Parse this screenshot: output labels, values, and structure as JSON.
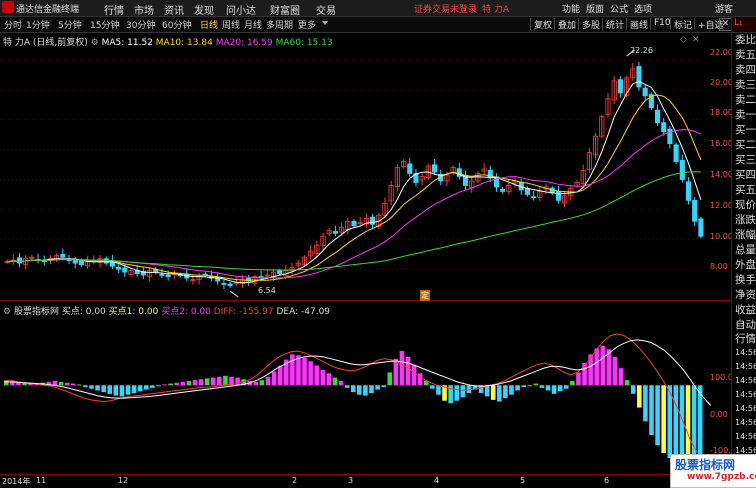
{
  "menubar": {
    "app_name": "通达信金融终端",
    "menus": [
      "行情",
      "市场",
      "资讯",
      "发现",
      "问小达",
      "财富圈",
      "交易"
    ],
    "notice": "证券交易未登录",
    "stock_name": "特 力A",
    "right": [
      "功能",
      "版面",
      "公式",
      "选项",
      "游客"
    ]
  },
  "toolbar": {
    "periods": [
      "分时",
      "1分钟",
      "5分钟",
      "15分钟",
      "30分钟",
      "60分钟",
      "日线",
      "周线",
      "月线",
      "多周期",
      "更多"
    ],
    "active_period": "日线",
    "buttons": [
      "复权",
      "叠加",
      "多股",
      "统计",
      "画线",
      "F10",
      "标记",
      "+自选"
    ]
  },
  "main_legend": {
    "title": "特 力A (日线,前复权)",
    "ma5": "MA5: 11.52",
    "ma10": "MA10: 13.84",
    "ma20": "MA20: 16.59",
    "ma60": "MA60: 15.13"
  },
  "indicator_legend": {
    "name": "股票指标网",
    "buy": "买点: 0.00",
    "buy1": "买点1: 0.00",
    "buy2": "买点2: 0.00",
    "diff": "DIFF: -155.97",
    "dea": "DEA: -47.09"
  },
  "price_axis": [
    "22.00",
    "20.00",
    "18.00",
    "16.00",
    "14.00",
    "12.00",
    "10.00",
    "8.00"
  ],
  "indicator_axis": [
    "100.0",
    "0.00",
    "-100.0"
  ],
  "annotations": {
    "high": "22.26",
    "low": "6.54",
    "marker": "定"
  },
  "x_axis": [
    "2014年",
    "11",
    "12",
    "2",
    "3",
    "4",
    "5",
    "6"
  ],
  "right_panel": [
    "委比",
    "卖五",
    "卖四",
    "卖三",
    "卖二",
    "卖一",
    "买一",
    "买二",
    "买三",
    "买四",
    "买五",
    "现价",
    "涨跌",
    "涨幅",
    "总量",
    "外盘",
    "换手",
    "净资",
    "收益",
    "自动",
    "行情",
    "14:56",
    "14:56",
    "14:56",
    "14:56",
    "14:56",
    "14:56",
    "14:56",
    "14:56"
  ],
  "watermark": {
    "line1": "股票指标网",
    "line2": "www.7gpzb.com"
  },
  "colors": {
    "ma5": "#ffffff",
    "ma10": "#ffd700",
    "ma20": "#ff33ff",
    "ma60": "#33dd33",
    "up": "#ff3b3b",
    "down": "#33d6ff"
  },
  "chart_data": {
    "type": "candlestick",
    "price_ylim": [
      6.0,
      23.0
    ],
    "indicator_ylim": [
      -200,
      150
    ],
    "closes": [
      8.5,
      8.6,
      8.4,
      8.7,
      8.8,
      8.6,
      8.5,
      8.7,
      8.9,
      8.8,
      8.6,
      8.4,
      8.3,
      8.5,
      8.6,
      8.7,
      8.4,
      8.2,
      8.0,
      7.8,
      7.9,
      7.7,
      7.6,
      7.9,
      7.8,
      7.6,
      7.5,
      7.7,
      7.6,
      7.4,
      7.3,
      7.5,
      7.6,
      7.4,
      7.2,
      7.0,
      6.9,
      7.1,
      7.3,
      7.2,
      7.5,
      7.4,
      7.6,
      7.8,
      7.7,
      7.9,
      8.1,
      8.4,
      8.8,
      9.2,
      9.6,
      10.2,
      10.6,
      10.4,
      10.8,
      11.2,
      10.9,
      11.1,
      11.4,
      11.0,
      11.6,
      12.4,
      13.6,
      14.8,
      15.2,
      14.4,
      13.8,
      14.2,
      14.9,
      14.5,
      13.9,
      14.3,
      14.8,
      14.2,
      13.6,
      13.9,
      14.4,
      14.7,
      14.1,
      13.5,
      13.2,
      13.6,
      13.9,
      13.3,
      13.0,
      12.8,
      13.2,
      13.5,
      13.1,
      12.6,
      12.9,
      13.4,
      13.8,
      14.6,
      15.8,
      16.9,
      18.2,
      19.4,
      20.6,
      19.8,
      20.8,
      21.4,
      20.2,
      19.6,
      18.8,
      17.8,
      17.2,
      16.4,
      15.2,
      14.0,
      12.6,
      11.2,
      10.2
    ],
    "highs": {
      "index": 100,
      "value": 22.26
    },
    "lows": {
      "index": 36,
      "value": 6.54
    },
    "macd_bars": [
      12,
      10,
      8,
      6,
      5,
      4,
      6,
      8,
      10,
      8,
      6,
      4,
      2,
      -4,
      -8,
      -12,
      -16,
      -20,
      -24,
      -26,
      -22,
      -18,
      -14,
      -10,
      -6,
      -2,
      2,
      4,
      6,
      8,
      10,
      12,
      14,
      16,
      18,
      20,
      22,
      20,
      18,
      14,
      10,
      8,
      12,
      20,
      32,
      46,
      60,
      72,
      70,
      64,
      56,
      46,
      36,
      28,
      18,
      10,
      -6,
      -16,
      -22,
      -24,
      -18,
      -10,
      -4,
      30,
      62,
      80,
      66,
      48,
      28,
      10,
      -8,
      -22,
      -36,
      -42,
      -36,
      -28,
      -18,
      -10,
      -18,
      -26,
      -34,
      -38,
      -30,
      -22,
      -12,
      -4,
      -2,
      4,
      -6,
      -12,
      -20,
      -14,
      -8,
      10,
      30,
      52,
      72,
      86,
      92,
      84,
      66,
      40,
      12,
      -20,
      -52,
      -84,
      -116,
      -140,
      -158,
      -170,
      -176,
      -180,
      -182,
      -184,
      -185
    ],
    "diff": [
      10,
      12,
      8,
      6,
      4,
      2,
      0,
      -2,
      -6,
      -12,
      -18,
      -24,
      -30,
      -34,
      -36,
      -38,
      -36,
      -32,
      -28,
      -26,
      -24,
      -22,
      -20,
      -18,
      -16,
      -14,
      -12,
      -10,
      -8,
      -6,
      -5,
      -4,
      -2,
      0,
      2,
      4,
      8,
      14,
      24,
      38,
      52,
      64,
      72,
      78,
      80,
      76,
      70,
      62,
      54,
      46,
      40,
      36,
      34,
      36,
      42,
      50,
      58,
      62,
      60,
      54,
      46,
      36,
      24,
      14,
      6,
      0,
      -4,
      -8,
      -10,
      -12,
      -10,
      -8,
      -4,
      0,
      4,
      10,
      18,
      26,
      34,
      42,
      48,
      52,
      48,
      40,
      30,
      24,
      30,
      44,
      64,
      86,
      104,
      116,
      120,
      116,
      106,
      92,
      74,
      54,
      32,
      8,
      -20,
      -52,
      -90,
      -130,
      -156
    ],
    "dea": [
      8,
      8,
      7,
      6,
      5,
      4,
      3,
      1,
      -1,
      -4,
      -8,
      -12,
      -16,
      -20,
      -24,
      -27,
      -29,
      -30,
      -30,
      -29,
      -28,
      -27,
      -26,
      -24,
      -22,
      -20,
      -18,
      -16,
      -14,
      -12,
      -10,
      -8,
      -6,
      -4,
      -2,
      0,
      2,
      6,
      12,
      20,
      30,
      40,
      48,
      56,
      62,
      66,
      68,
      68,
      66,
      62,
      58,
      54,
      50,
      48,
      48,
      50,
      52,
      54,
      56,
      56,
      54,
      50,
      44,
      38,
      32,
      26,
      20,
      14,
      8,
      4,
      0,
      -2,
      -2,
      0,
      2,
      6,
      10,
      16,
      22,
      28,
      34,
      40,
      44,
      44,
      42,
      38,
      36,
      38,
      44,
      54,
      66,
      78,
      90,
      98,
      104,
      106,
      104,
      100,
      92,
      82,
      68,
      52,
      34,
      12,
      -10,
      -30,
      -47
    ]
  }
}
